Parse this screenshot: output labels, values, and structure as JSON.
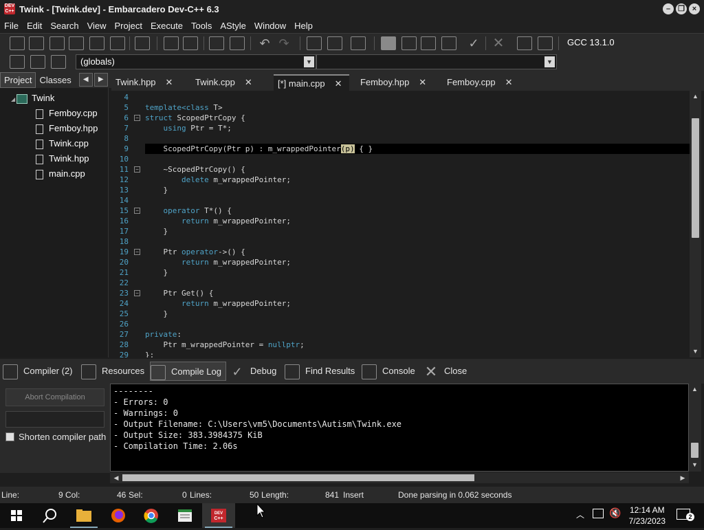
{
  "window": {
    "title": "Twink - [Twink.dev] - Embarcadero Dev-C++ 6.3"
  },
  "menu": [
    "File",
    "Edit",
    "Search",
    "View",
    "Project",
    "Execute",
    "Tools",
    "AStyle",
    "Window",
    "Help"
  ],
  "compiler_select": "GCC 13.1.0",
  "scope_combo": "(globals)",
  "left_tabs": {
    "project": "Project",
    "classes": "Classes"
  },
  "tree": {
    "root": "Twink",
    "files": [
      "Femboy.cpp",
      "Femboy.hpp",
      "Twink.cpp",
      "Twink.hpp",
      "main.cpp"
    ]
  },
  "editor_tabs": [
    "Twink.hpp",
    "Twink.cpp",
    "[*] main.cpp",
    "Femboy.hpp",
    "Femboy.cpp"
  ],
  "code": {
    "line_numbers": [
      "4",
      "5",
      "6",
      "7",
      "8",
      "9",
      "10",
      "11",
      "12",
      "13",
      "14",
      "15",
      "16",
      "17",
      "18",
      "19",
      "20",
      "21",
      "22",
      "23",
      "24",
      "25",
      "26",
      "27",
      "28",
      "29"
    ]
  },
  "bottom_tabs": {
    "compiler": "Compiler (2)",
    "resources": "Resources",
    "compile_log": "Compile Log",
    "debug": "Debug",
    "find_results": "Find Results",
    "console": "Console",
    "close": "Close"
  },
  "abort_button": "Abort Compilation",
  "shorten_label": "Shorten compiler path",
  "log_lines": [
    "--------",
    "- Errors: 0",
    "- Warnings: 0",
    "- Output Filename: C:\\Users\\vm5\\Documents\\Autism\\Twink.exe",
    "- Output Size: 383.3984375 KiB",
    "- Compilation Time: 2.06s"
  ],
  "status": {
    "line_label": "Line:",
    "line_val": "9",
    "col_label": "Col:",
    "col_val": "46",
    "sel_label": "Sel:",
    "sel_val": "0",
    "lines_label": "Lines:",
    "lines_val": "50",
    "length_label": "Length:",
    "length_val": "841",
    "mode": "Insert",
    "message": "Done parsing in 0.062 seconds"
  },
  "clock": {
    "time": "12:14 AM",
    "date": "7/23/2023"
  },
  "notifications": "2",
  "colors": {
    "keyword": "#4fa3c7",
    "accent": "#c1272d"
  }
}
